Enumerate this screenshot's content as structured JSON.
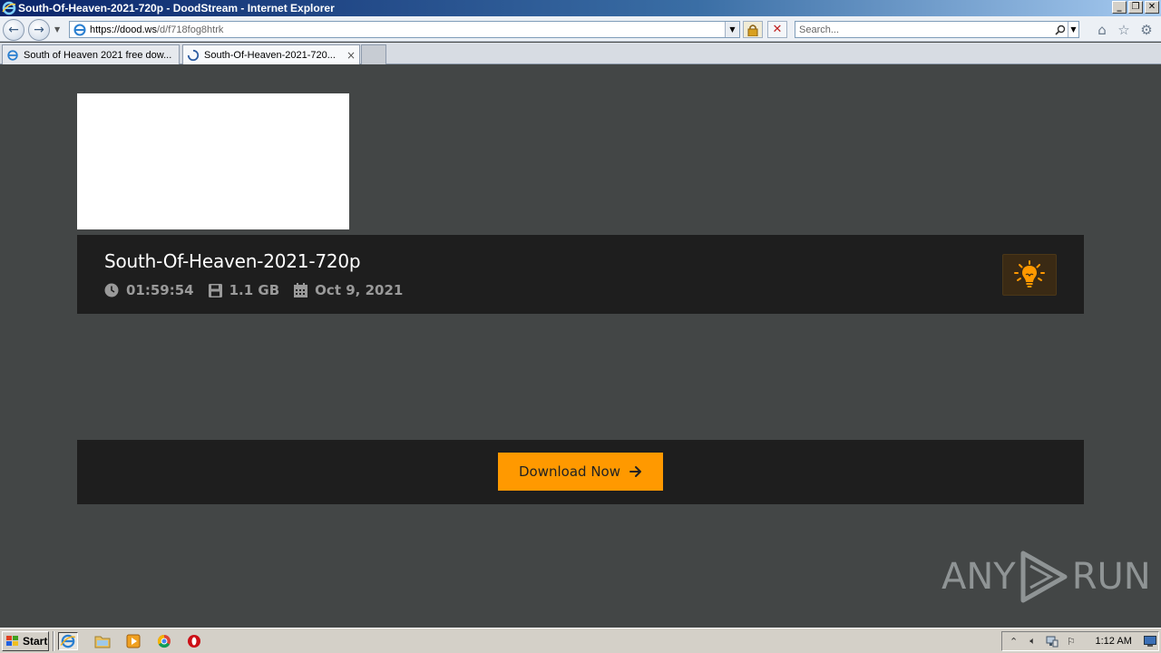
{
  "window": {
    "title": "South-Of-Heaven-2021-720p - DoodStream - Internet Explorer",
    "controls": [
      "minimize",
      "restore",
      "close"
    ]
  },
  "navbar": {
    "url_host": "https://dood.ws",
    "url_path": "/d/f718fog8htrk",
    "search_placeholder": "Search..."
  },
  "tabs": [
    {
      "label": "South of Heaven 2021 free dow...",
      "active": false,
      "icon": "ie-page-icon"
    },
    {
      "label": "South-Of-Heaven-2021-720...",
      "active": true,
      "icon": "loading-icon",
      "close": "×"
    }
  ],
  "video": {
    "title": "South-Of-Heaven-2021-720p",
    "duration": "01:59:54",
    "size": "1.1 GB",
    "date": "Oct 9, 2021"
  },
  "download": {
    "label": "Download Now",
    "color": "#ff9900"
  },
  "watermark": {
    "left": "ANY",
    "right": "RUN"
  },
  "taskbar": {
    "start_label": "Start",
    "clock": "1:12 AM",
    "quicklaunch": [
      "ie-icon",
      "folder-icon",
      "media-player-icon",
      "chrome-icon",
      "opera-icon"
    ]
  }
}
